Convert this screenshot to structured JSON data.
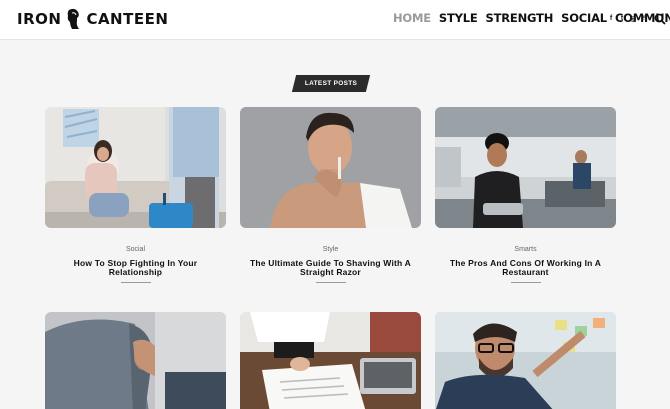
{
  "brand": {
    "left": "IRON",
    "right": "CANTEEN"
  },
  "nav": [
    {
      "label": "HOME",
      "active": true
    },
    {
      "label": "STYLE",
      "active": false
    },
    {
      "label": "STRENGTH",
      "active": false
    },
    {
      "label": "SOCIAL",
      "active": false
    },
    {
      "label": "COMMUNITY",
      "active": false
    }
  ],
  "social_icons": [
    "facebook-icon",
    "twitter-icon",
    "instagram-icon",
    "pinterest-icon"
  ],
  "social_glyphs": [
    "f",
    "t",
    "◎",
    "℗"
  ],
  "section_badge": "LATEST POSTS",
  "posts": [
    {
      "category": "Social",
      "title": "How To Stop Fighting In Your Relationship"
    },
    {
      "category": "Style",
      "title": "The Ultimate Guide To Shaving With A Straight Razor"
    },
    {
      "category": "Smarts",
      "title": "The Pros And Cons Of Working In A Restaurant"
    }
  ],
  "colors": {
    "accent_dark": "#2b2b2b",
    "nav_active": "#9a9a9a",
    "background": "#f5f5f5"
  }
}
